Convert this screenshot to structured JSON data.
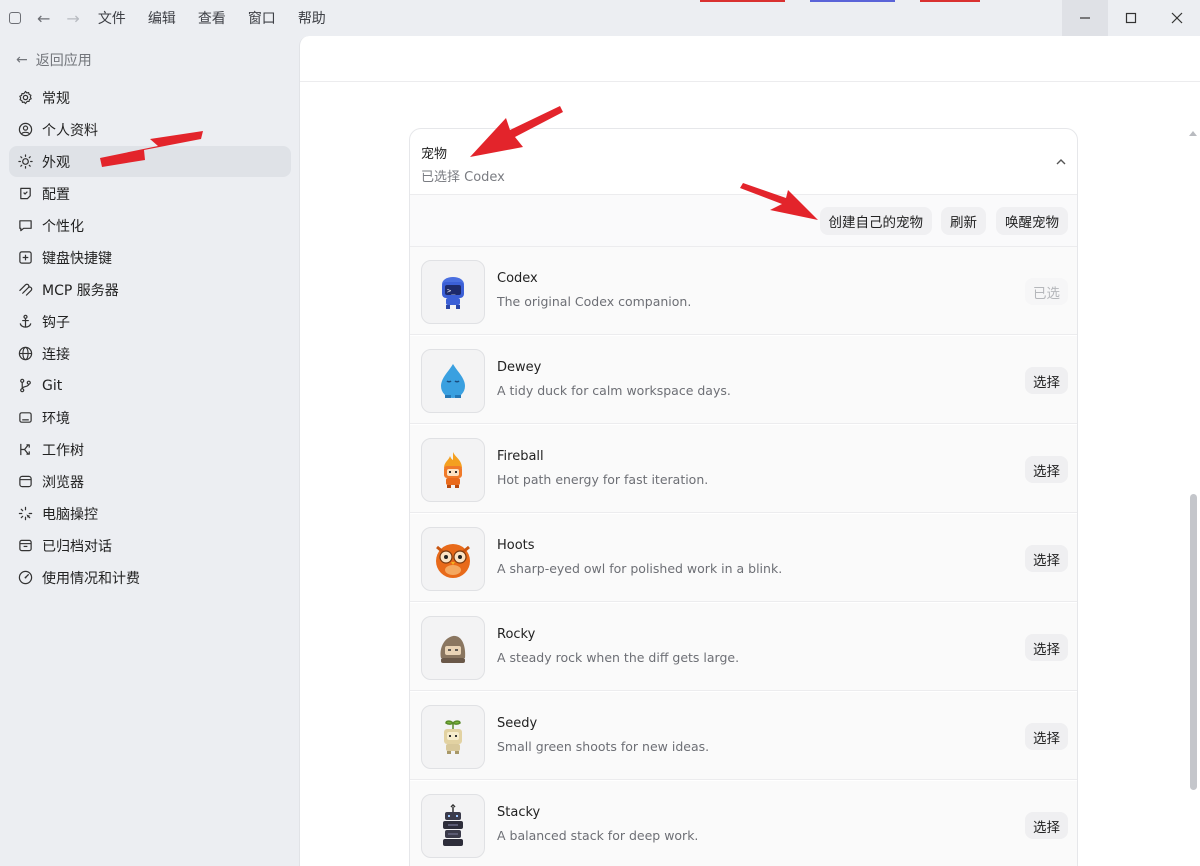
{
  "titlebar": {
    "menus": [
      "文件",
      "编辑",
      "查看",
      "窗口",
      "帮助"
    ],
    "window_controls": [
      "minimize-icon",
      "maximize-icon",
      "close-icon"
    ]
  },
  "sidebar": {
    "back_label": "返回应用",
    "items": [
      {
        "label": "常规",
        "icon": "gear-icon"
      },
      {
        "label": "个人资料",
        "icon": "user-circle-icon"
      },
      {
        "label": "外观",
        "icon": "sun-icon",
        "active": true
      },
      {
        "label": "配置",
        "icon": "config-icon"
      },
      {
        "label": "个性化",
        "icon": "chat-bubble-icon"
      },
      {
        "label": "键盘快捷键",
        "icon": "keyboard-icon"
      },
      {
        "label": "MCP 服务器",
        "icon": "mcp-icon"
      },
      {
        "label": "钩子",
        "icon": "anchor-icon"
      },
      {
        "label": "连接",
        "icon": "globe-icon"
      },
      {
        "label": "Git",
        "icon": "git-branch-icon"
      },
      {
        "label": "环境",
        "icon": "terminal-icon"
      },
      {
        "label": "工作树",
        "icon": "worktree-icon"
      },
      {
        "label": "浏览器",
        "icon": "browser-icon"
      },
      {
        "label": "电脑操控",
        "icon": "sparkle-icon"
      },
      {
        "label": "已归档对话",
        "icon": "archive-icon"
      },
      {
        "label": "使用情况和计费",
        "icon": "gauge-icon"
      }
    ]
  },
  "pets": {
    "title": "宠物",
    "subtitle": "已选择 Codex",
    "actions": {
      "create": "创建自己的宠物",
      "refresh": "刷新",
      "wake": "唤醒宠物"
    },
    "list": [
      {
        "name": "Codex",
        "desc": "The original Codex companion.",
        "button": "已选",
        "selected": true,
        "color": "#3b5fd6"
      },
      {
        "name": "Dewey",
        "desc": "A tidy duck for calm workspace days.",
        "button": "选择",
        "selected": false,
        "color": "#3aa0e0"
      },
      {
        "name": "Fireball",
        "desc": "Hot path energy for fast iteration.",
        "button": "选择",
        "selected": false,
        "color": "#f07a2a"
      },
      {
        "name": "Hoots",
        "desc": "A sharp-eyed owl for polished work in a blink.",
        "button": "选择",
        "selected": false,
        "color": "#e86a1a"
      },
      {
        "name": "Rocky",
        "desc": "A steady rock when the diff gets large.",
        "button": "选择",
        "selected": false,
        "color": "#8a7660"
      },
      {
        "name": "Seedy",
        "desc": "Small green shoots for new ideas.",
        "button": "选择",
        "selected": false,
        "color": "#d8c89a"
      },
      {
        "name": "Stacky",
        "desc": "A balanced stack for deep work.",
        "button": "选择",
        "selected": false,
        "color": "#3a3a4a"
      }
    ]
  },
  "annotation_color": "#e3242b"
}
